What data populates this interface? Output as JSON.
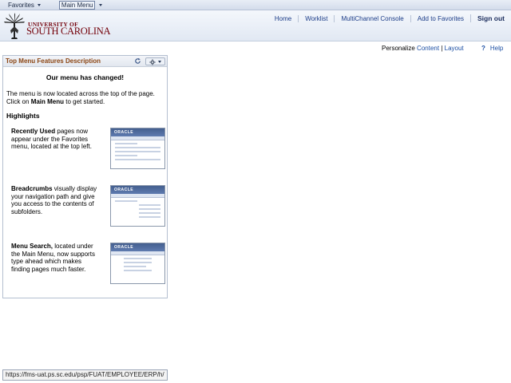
{
  "menubar": {
    "favorites_label": "Favorites",
    "main_menu_label": "Main Menu"
  },
  "header": {
    "logo_line1": "UNIVERSITY OF",
    "logo_line2": "SOUTH CAROLINA",
    "nav": {
      "home": "Home",
      "worklist": "Worklist",
      "multichannel": "MultiChannel Console",
      "add_favorites": "Add to Favorites",
      "sign_out": "Sign out"
    }
  },
  "personalize": {
    "label": "Personalize",
    "content_link": "Content",
    "separator": "|",
    "layout_link": "Layout",
    "help_link": "Help"
  },
  "pagelet": {
    "title": "Top Menu Features Description",
    "heading": "Our menu has changed!",
    "intro_1": "The menu is now located across the top of the page. Click on",
    "intro_bold": "Main Menu",
    "intro_2": "to get started.",
    "highlights": "Highlights",
    "features": [
      {
        "bold": "Recently Used",
        "text": " pages now appear under the Favorites menu, located at the top left."
      },
      {
        "bold": "Breadcrumbs",
        "text": " visually display your navigation path and give you access to the contents of subfolders."
      },
      {
        "bold": "Menu Search,",
        "text": " located under the Main Menu, now supports type ahead which makes finding pages much faster."
      }
    ],
    "thumb_brand": "ORACLE"
  },
  "statusbar": {
    "url": "https://fms-uat.ps.sc.edu/psp/FUAT/EMPLOYEE/ERP/h/"
  },
  "colors": {
    "brand_garnet": "#73000a",
    "link_blue": "#1b4ea3",
    "pagelet_title": "#8b4513"
  }
}
